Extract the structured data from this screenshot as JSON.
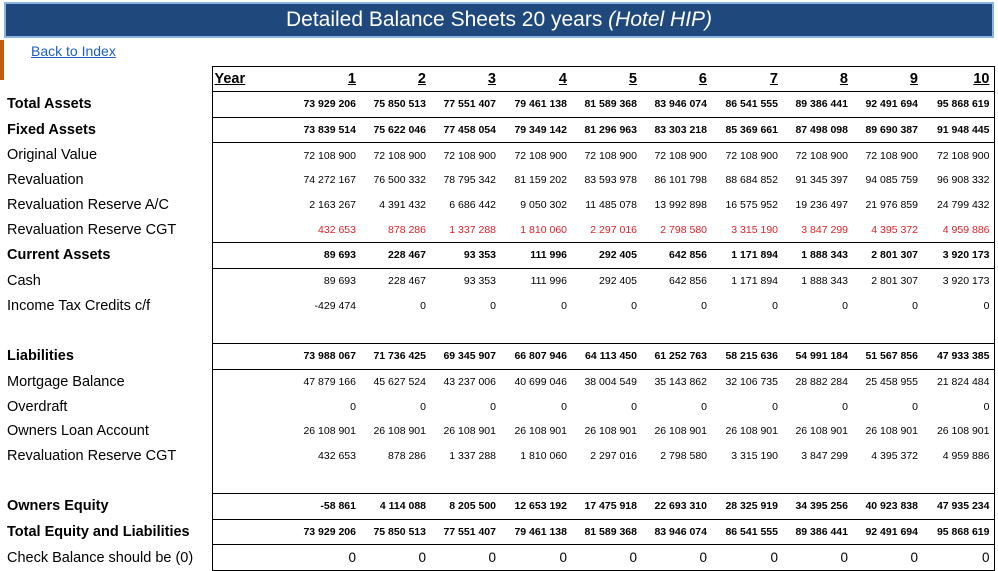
{
  "title": {
    "main": "Detailed Balance Sheets 20 years ",
    "sub": "(Hotel HIP)"
  },
  "back_link": "Back to Index",
  "header": {
    "year_label": "Year",
    "years": [
      "1",
      "2",
      "3",
      "4",
      "5",
      "6",
      "7",
      "8",
      "9",
      "10"
    ]
  },
  "rows": [
    {
      "label": "Total Assets",
      "style": "bold",
      "values": [
        "73 929 206",
        "75 850 513",
        "77 551 407",
        "79 461 138",
        "81 589 368",
        "83 946 074",
        "86 541 555",
        "89 386 441",
        "92 491 694",
        "95 868 619"
      ]
    },
    {
      "label": "Fixed Assets",
      "style": "bold",
      "values": [
        "73 839 514",
        "75 622 046",
        "77 458 054",
        "79 349 142",
        "81 296 963",
        "83 303 218",
        "85 369 661",
        "87 498 098",
        "89 690 387",
        "91 948 445"
      ]
    },
    {
      "label": "Original Value",
      "style": "normal",
      "values": [
        "72 108 900",
        "72 108 900",
        "72 108 900",
        "72 108 900",
        "72 108 900",
        "72 108 900",
        "72 108 900",
        "72 108 900",
        "72 108 900",
        "72 108 900"
      ]
    },
    {
      "label": "Revaluation",
      "style": "normal",
      "values": [
        "74 272 167",
        "76 500 332",
        "78 795 342",
        "81 159 202",
        "83 593 978",
        "86 101 798",
        "88 684 852",
        "91 345 397",
        "94 085 759",
        "96 908 332"
      ]
    },
    {
      "label": "Revaluation Reserve A/C",
      "style": "normal",
      "values": [
        "2 163 267",
        "4 391 432",
        "6 686 442",
        "9 050 302",
        "11 485 078",
        "13 992 898",
        "16 575 952",
        "19 236 497",
        "21 976 859",
        "24 799 432"
      ]
    },
    {
      "label": "Revaluation Reserve CGT",
      "style": "red",
      "values": [
        "432 653",
        "878 286",
        "1 337 288",
        "1 810 060",
        "2 297 016",
        "2 798 580",
        "3 315 190",
        "3 847 299",
        "4 395 372",
        "4 959 886"
      ]
    },
    {
      "label": "Current Assets",
      "style": "bold",
      "values": [
        "89 693",
        "228 467",
        "93 353",
        "111 996",
        "292 405",
        "642 856",
        "1 171 894",
        "1 888 343",
        "2 801 307",
        "3 920 173"
      ]
    },
    {
      "label": "Cash",
      "style": "normal",
      "values": [
        "89 693",
        "228 467",
        "93 353",
        "111 996",
        "292 405",
        "642 856",
        "1 171 894",
        "1 888 343",
        "2 801 307",
        "3 920 173"
      ]
    },
    {
      "label": "Income Tax Credits c/f",
      "style": "normal",
      "values": [
        "-429 474",
        "0",
        "0",
        "0",
        "0",
        "0",
        "0",
        "0",
        "0",
        "0"
      ]
    },
    {
      "label": "",
      "style": "blank",
      "values": [
        "",
        "",
        "",
        "",
        "",
        "",
        "",
        "",
        "",
        ""
      ]
    },
    {
      "label": "Liabilities",
      "style": "bold",
      "values": [
        "73 988 067",
        "71 736 425",
        "69 345 907",
        "66 807 946",
        "64 113 450",
        "61 252 763",
        "58 215 636",
        "54 991 184",
        "51 567 856",
        "47 933 385"
      ]
    },
    {
      "label": "Mortgage Balance",
      "style": "normal",
      "values": [
        "47 879 166",
        "45 627 524",
        "43 237 006",
        "40 699 046",
        "38 004 549",
        "35 143 862",
        "32 106 735",
        "28 882 284",
        "25 458 955",
        "21 824 484"
      ]
    },
    {
      "label": "Overdraft",
      "style": "normal",
      "values": [
        "0",
        "0",
        "0",
        "0",
        "0",
        "0",
        "0",
        "0",
        "0",
        "0"
      ]
    },
    {
      "label": "Owners Loan Account",
      "style": "normal",
      "values": [
        "26 108 901",
        "26 108 901",
        "26 108 901",
        "26 108 901",
        "26 108 901",
        "26 108 901",
        "26 108 901",
        "26 108 901",
        "26 108 901",
        "26 108 901"
      ]
    },
    {
      "label": "Revaluation Reserve CGT",
      "style": "normal",
      "values": [
        "432 653",
        "878 286",
        "1 337 288",
        "1 810 060",
        "2 297 016",
        "2 798 580",
        "3 315 190",
        "3 847 299",
        "4 395 372",
        "4 959 886"
      ]
    },
    {
      "label": "",
      "style": "blank",
      "values": [
        "",
        "",
        "",
        "",
        "",
        "",
        "",
        "",
        "",
        ""
      ]
    },
    {
      "label": "Owners Equity",
      "style": "bold",
      "values": [
        "-58 861",
        "4 114 088",
        "8 205 500",
        "12 653 192",
        "17 475 918",
        "22 693 310",
        "28 325 919",
        "34 395 256",
        "40 923 838",
        "47 935 234"
      ]
    },
    {
      "label": "Total Equity and Liabilities",
      "style": "bold",
      "values": [
        "73 929 206",
        "75 850 513",
        "77 551 407",
        "79 461 138",
        "81 589 368",
        "83 946 074",
        "86 541 555",
        "89 386 441",
        "92 491 694",
        "95 868 619"
      ]
    },
    {
      "label": "Check Balance should be (0)",
      "style": "check",
      "values": [
        "0",
        "0",
        "0",
        "0",
        "0",
        "0",
        "0",
        "0",
        "0",
        "0"
      ]
    }
  ],
  "colors": {
    "title_bg": "#1f497d",
    "title_border": "#8db3e2",
    "negative_red": "#e0202a",
    "link": "#1f5fbf"
  }
}
